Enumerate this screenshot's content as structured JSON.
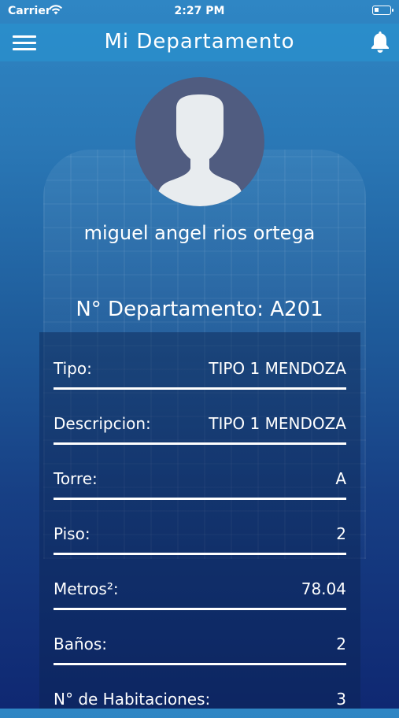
{
  "status_bar": {
    "carrier": "Carrier",
    "time": "2:27 PM"
  },
  "nav": {
    "title": "Mi Departamento"
  },
  "user": {
    "name": "miguel angel rios ortega"
  },
  "department": {
    "title": "N° Departamento: A201"
  },
  "details": [
    {
      "label": "Tipo:",
      "value": "TIPO 1 MENDOZA"
    },
    {
      "label": "Descripcion:",
      "value": "TIPO 1 MENDOZA"
    },
    {
      "label": "Torre:",
      "value": "A"
    },
    {
      "label": "Piso:",
      "value": "2"
    },
    {
      "label": "Metros²:",
      "value": "78.04"
    },
    {
      "label": "Baños:",
      "value": "2"
    },
    {
      "label": "N° de Habitaciones:",
      "value": "3"
    }
  ],
  "icons": {
    "menu": "hamburger-menu-icon",
    "notifications": "bell-icon",
    "avatar": "user-silhouette-icon",
    "wifi": "wifi-icon",
    "battery": "battery-icon"
  }
}
